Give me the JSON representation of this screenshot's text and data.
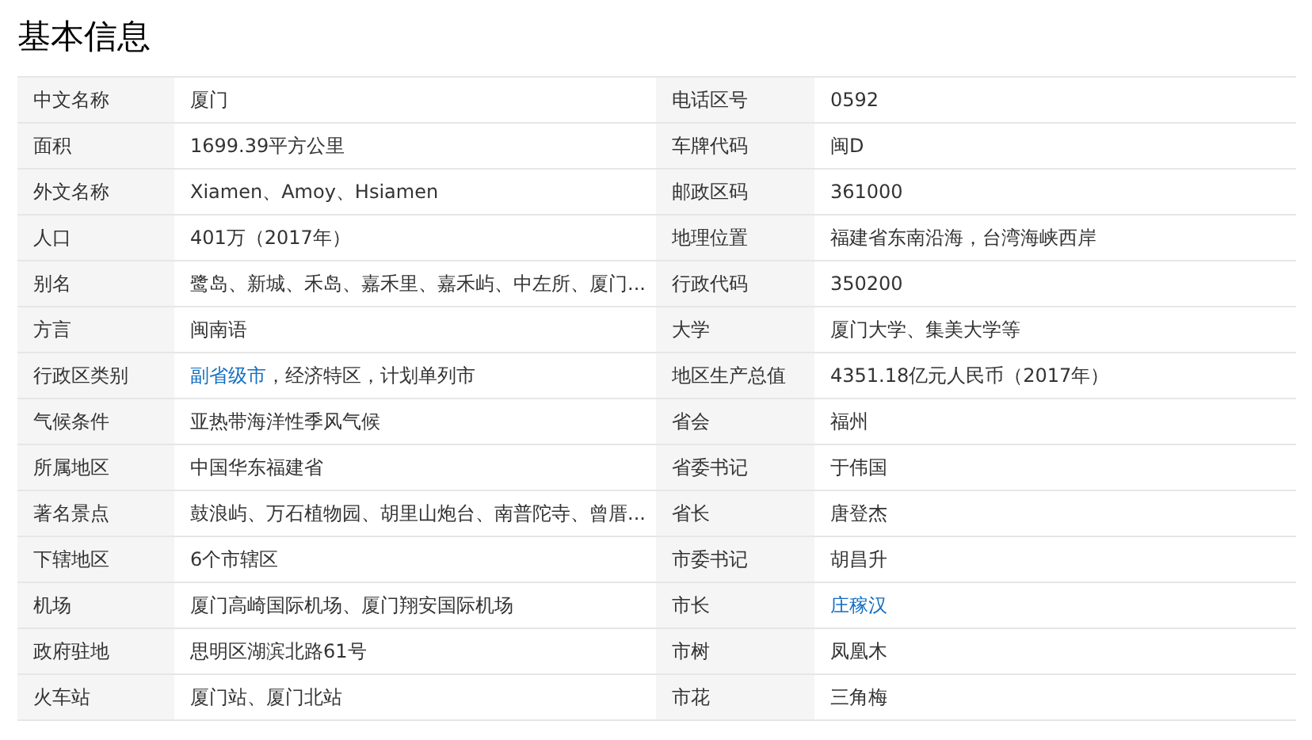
{
  "title": "基本信息",
  "rows": [
    {
      "left": {
        "label": "中文名称",
        "value": [
          {
            "text": "厦门",
            "link": false
          }
        ]
      },
      "right": {
        "label": "电话区号",
        "value": [
          {
            "text": "0592",
            "link": false
          }
        ]
      }
    },
    {
      "left": {
        "label": "面积",
        "value": [
          {
            "text": "1699.39平方公里",
            "link": false
          }
        ]
      },
      "right": {
        "label": "车牌代码",
        "value": [
          {
            "text": "闽D",
            "link": false
          }
        ]
      }
    },
    {
      "left": {
        "label": "外文名称",
        "value": [
          {
            "text": "Xiamen、Amoy、Hsiamen",
            "link": false
          }
        ]
      },
      "right": {
        "label": "邮政区码",
        "value": [
          {
            "text": "361000",
            "link": false
          }
        ]
      }
    },
    {
      "left": {
        "label": "人口",
        "value": [
          {
            "text": "401万（2017年）",
            "link": false
          }
        ]
      },
      "right": {
        "label": "地理位置",
        "value": [
          {
            "text": "福建省东南沿海，台湾海峡西岸",
            "link": false
          }
        ]
      }
    },
    {
      "left": {
        "label": "别名",
        "value": [
          {
            "text": "鹭岛、新城、禾岛、嘉禾里、嘉禾屿、中左所、厦门...",
            "link": false
          }
        ]
      },
      "right": {
        "label": "行政代码",
        "value": [
          {
            "text": "350200",
            "link": false
          }
        ]
      }
    },
    {
      "left": {
        "label": "方言",
        "value": [
          {
            "text": "闽南语",
            "link": false
          }
        ]
      },
      "right": {
        "label": "大学",
        "value": [
          {
            "text": "厦门大学、集美大学等",
            "link": false
          }
        ]
      }
    },
    {
      "left": {
        "label": "行政区类别",
        "value": [
          {
            "text": "副省级市",
            "link": true
          },
          {
            "text": "，经济特区，计划单列市",
            "link": false
          }
        ]
      },
      "right": {
        "label": "地区生产总值",
        "value": [
          {
            "text": "4351.18亿元人民币（2017年）",
            "link": false
          }
        ]
      }
    },
    {
      "left": {
        "label": "气候条件",
        "value": [
          {
            "text": "亚热带海洋性季风气候",
            "link": false
          }
        ]
      },
      "right": {
        "label": "省会",
        "value": [
          {
            "text": "福州",
            "link": false
          }
        ]
      }
    },
    {
      "left": {
        "label": "所属地区",
        "value": [
          {
            "text": "中国华东福建省",
            "link": false
          }
        ]
      },
      "right": {
        "label": "省委书记",
        "value": [
          {
            "text": "于伟国",
            "link": false
          }
        ]
      }
    },
    {
      "left": {
        "label": "著名景点",
        "value": [
          {
            "text": "鼓浪屿、万石植物园、胡里山炮台、南普陀寺、曾厝...",
            "link": false
          }
        ]
      },
      "right": {
        "label": "省长",
        "value": [
          {
            "text": "唐登杰",
            "link": false
          }
        ]
      }
    },
    {
      "left": {
        "label": "下辖地区",
        "value": [
          {
            "text": "6个市辖区",
            "link": false
          }
        ]
      },
      "right": {
        "label": "市委书记",
        "value": [
          {
            "text": "胡昌升",
            "link": false
          }
        ]
      }
    },
    {
      "left": {
        "label": "机场",
        "value": [
          {
            "text": "厦门高崎国际机场、厦门翔安国际机场",
            "link": false
          }
        ]
      },
      "right": {
        "label": "市长",
        "value": [
          {
            "text": "庄稼汉",
            "link": true
          }
        ]
      }
    },
    {
      "left": {
        "label": "政府驻地",
        "value": [
          {
            "text": "思明区湖滨北路61号",
            "link": false
          }
        ]
      },
      "right": {
        "label": "市树",
        "value": [
          {
            "text": "凤凰木",
            "link": false
          }
        ]
      }
    },
    {
      "left": {
        "label": "火车站",
        "value": [
          {
            "text": "厦门站、厦门北站",
            "link": false
          }
        ]
      },
      "right": {
        "label": "市花",
        "value": [
          {
            "text": "三角梅",
            "link": false
          }
        ]
      }
    }
  ]
}
